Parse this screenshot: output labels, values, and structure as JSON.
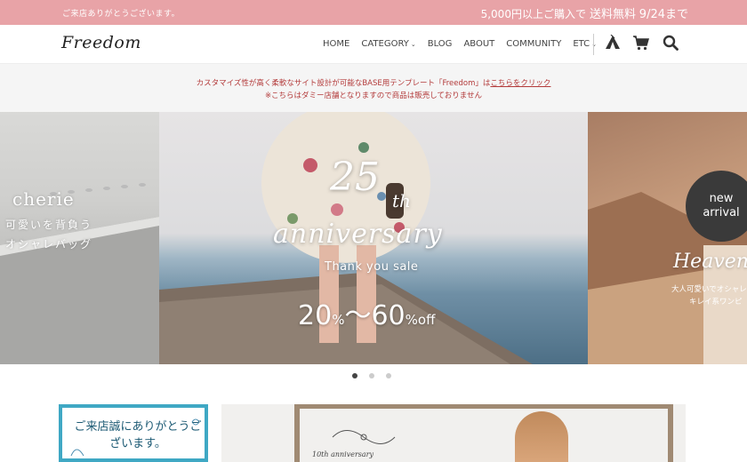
{
  "topbar": {
    "welcome": "ご来店ありがとうございます。",
    "promo_prefix": "5,000円以上ご購入で",
    "promo_free": "送料無料",
    "promo_date": "9/24まで",
    "bg_color": "#e8a3a7"
  },
  "header": {
    "logo": "Freedom",
    "nav": [
      {
        "label": "HOME",
        "has_dropdown": false
      },
      {
        "label": "CATEGORY",
        "has_dropdown": true
      },
      {
        "label": "BLOG",
        "has_dropdown": false
      },
      {
        "label": "ABOUT",
        "has_dropdown": false
      },
      {
        "label": "COMMUNITY",
        "has_dropdown": false
      },
      {
        "label": "ETC",
        "has_dropdown": true
      }
    ],
    "icons": [
      "tent-icon",
      "cart-icon",
      "search-icon"
    ]
  },
  "notice": {
    "line1_prefix": "カスタマイズ性が高く柔軟なサイト設計が可能なBASE用テンプレート「Freedom」は",
    "line1_link": "こちらをクリック",
    "line2": "※こちらはダミー店舗となりますので商品は販売しておりません",
    "text_color": "#b33a3a"
  },
  "hero": {
    "left": {
      "title": "cherie",
      "sub1": "可愛いを背負う",
      "sub2": "オシャレバッグ"
    },
    "center": {
      "big": "25",
      "sup": "th",
      "word": "anniversary",
      "thanks": "Thank you sale",
      "sale_from": "20",
      "pct1": "%",
      "tilde": "～",
      "sale_to": "60",
      "pct2": "%off"
    },
    "right": {
      "badge_line1": "new",
      "badge_line2": "arrival",
      "title": "Heaven",
      "sub1": "大人可愛いでオシャレ",
      "sub2": "キレイ系ワンピ"
    },
    "dots": {
      "count": 3,
      "active": 0
    }
  },
  "banners": {
    "left_text": "ご来店誠にありがとうございます。",
    "left_border_color": "#3fa8c4",
    "right_label": "10th anniversary"
  }
}
